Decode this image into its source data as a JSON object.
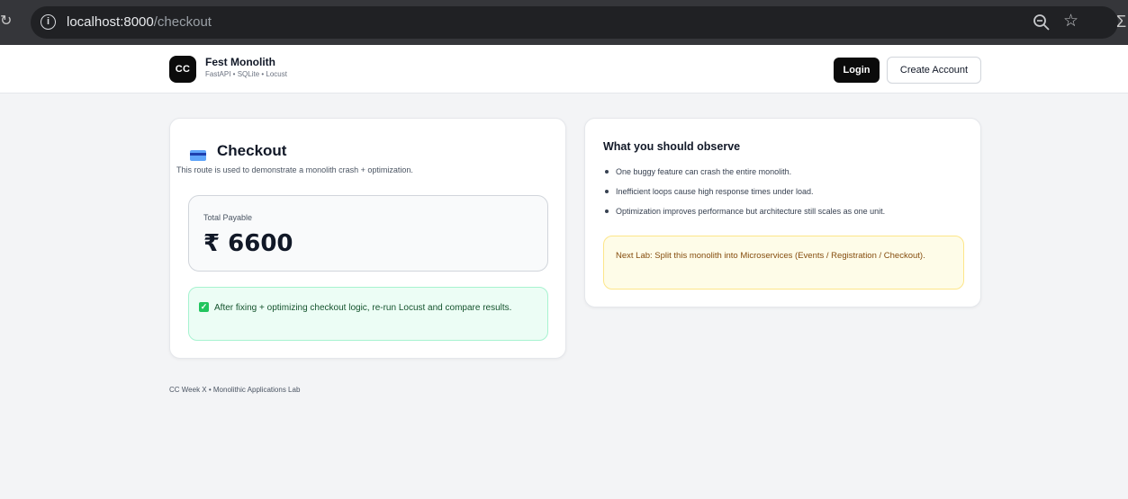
{
  "browser": {
    "url_host": "localhost:8000",
    "url_path": "/checkout",
    "info_glyph": "i",
    "icons": [
      "info-icon",
      "zoom-icon",
      "star-icon",
      "reload-icon",
      "extensions-icon"
    ]
  },
  "nav": {
    "logo_text": "CC",
    "brand_name": "Fest Monolith",
    "brand_sub": "FastAPI • SQLite • Locust",
    "login_label": "Login",
    "create_account_label": "Create Account"
  },
  "checkout": {
    "title": "Checkout",
    "description": "This route is used to demonstrate a monolith crash + optimization.",
    "total_label": "Total Payable",
    "total_amount": "₹ 6600",
    "success_message": "After fixing + optimizing checkout logic, re-run Locust and compare results."
  },
  "observe": {
    "title": "What you should observe",
    "items": [
      "One buggy feature can crash the entire monolith.",
      "Inefficient loops cause high response times under load.",
      "Optimization improves performance but architecture still scales as one unit."
    ],
    "note": "Next Lab: Split this monolith into Microservices (Events / Registration / Checkout)."
  },
  "footer": {
    "text": "CC Week X • Monolithic Applications Lab"
  },
  "colors": {
    "page_bg": "#f3f4f6",
    "primary_button": "#0b0b0b",
    "success_bg": "#ecfdf5",
    "note_bg": "#fefce8"
  }
}
